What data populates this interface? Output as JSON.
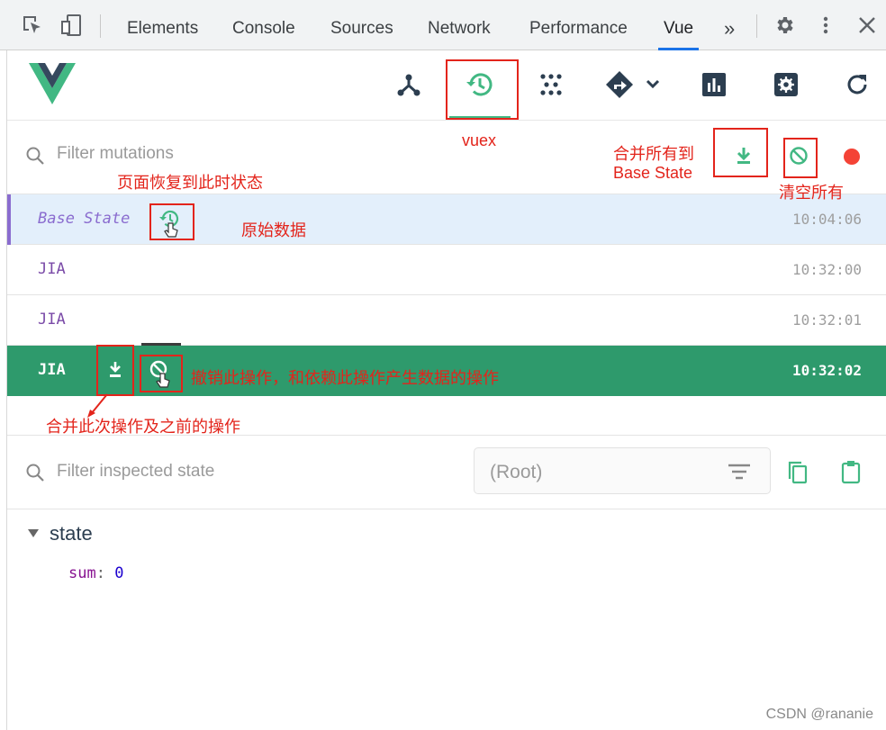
{
  "devtools": {
    "tabs": [
      "Elements",
      "Console",
      "Sources",
      "Network",
      "Performance",
      "Vue"
    ],
    "active_tab": "Vue",
    "overflow_label": "»"
  },
  "vue_toolbar": {
    "icons": [
      "component-tree-icon",
      "timeline-history-icon",
      "events-icon",
      "router-icon",
      "performance-chart-icon",
      "settings-icon",
      "refresh-icon"
    ],
    "accent_color": "#42b883"
  },
  "mutations": {
    "filter_placeholder": "Filter mutations",
    "rows": [
      {
        "name": "Base State",
        "time": "10:04:06"
      },
      {
        "name": "JIA",
        "time": "10:32:00"
      },
      {
        "name": "JIA",
        "time": "10:32:01"
      },
      {
        "name": "JIA",
        "time": "10:32:02"
      }
    ]
  },
  "inspector": {
    "filter_placeholder": "Filter inspected state",
    "root_label": "(Root)",
    "section": "state",
    "key": "sum",
    "colon": ":",
    "value": "0"
  },
  "annotations": {
    "vuex": "vuex",
    "commit_all_line1": "合并所有到",
    "commit_all_line2": "Base State",
    "clear_all": "清空所有",
    "revert_page": "页面恢复到此时状态",
    "original_data": "原始数据",
    "revert_op": "撤销此操作，和依赖此操作产生数据的操作",
    "commit_op": "合并此次操作及之前的操作"
  },
  "watermark": "CSDN @rananie"
}
